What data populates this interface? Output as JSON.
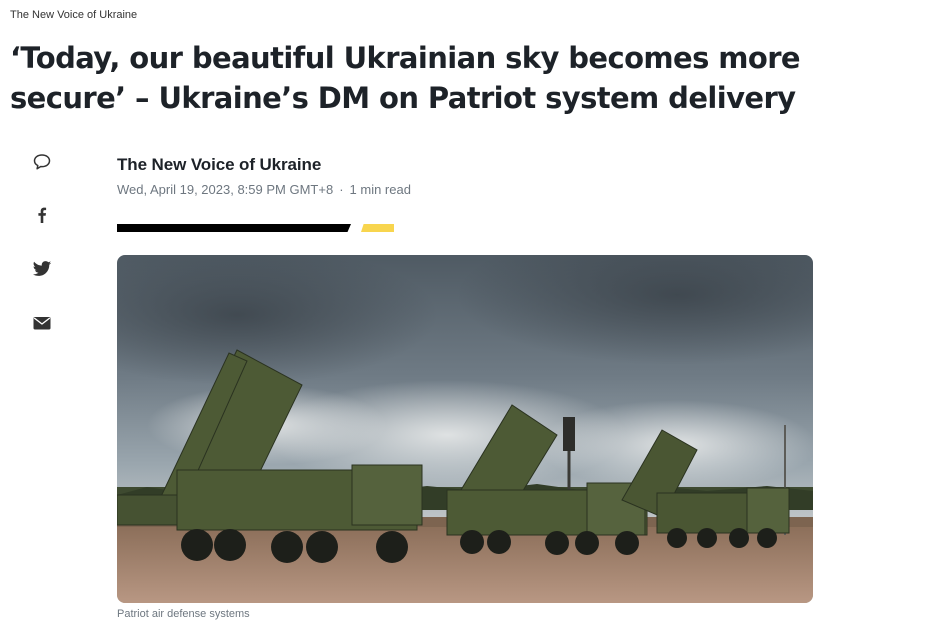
{
  "publisher": {
    "name": "The New Voice of Ukraine"
  },
  "article": {
    "headline": "‘Today, our beautiful Ukrainian sky becomes more secure’ – Ukraine’s DM on Patriot system delivery",
    "author": "The New Voice of Ukraine",
    "date": "Wed, April 19, 2023, 8:59 PM GMT+8",
    "separator": "·",
    "read_time": "1 min read",
    "image_caption": "Patriot air defense systems"
  },
  "share_icons": [
    "comment-icon",
    "facebook-icon",
    "twitter-icon",
    "email-icon"
  ],
  "colors": {
    "text": "#1d2228",
    "meta": "#6e7780",
    "accent": "#f8d54e",
    "bar": "#000000"
  }
}
